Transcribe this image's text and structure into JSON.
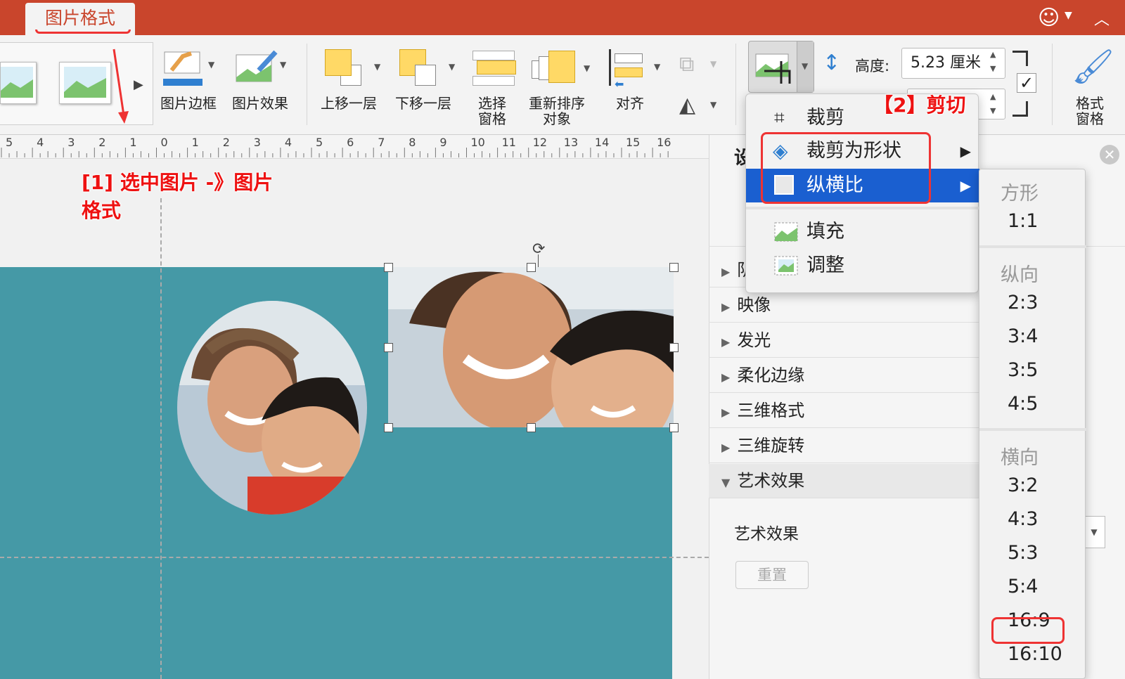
{
  "titlebar": {
    "active_tab": "图片格式",
    "colors": {
      "bar": "#c9452c",
      "accent_red": "#e33333"
    },
    "icons": [
      "smiley-icon",
      "collapse-ribbon-icon"
    ]
  },
  "ribbon": {
    "picture_border": "图片边框",
    "picture_effects": "图片效果",
    "bring_forward": "上移一层",
    "send_backward": "下移一层",
    "selection_pane_1": "选择",
    "selection_pane_2": "窗格",
    "reorder_1": "重新排序",
    "reorder_2": "对象",
    "align": "对齐",
    "height_label": "高度:",
    "height_value": "5.23 厘米",
    "format_pane_1": "格式",
    "format_pane_2": "窗格"
  },
  "ruler": {
    "labels": [
      "5",
      "4",
      "3",
      "2",
      "1",
      "0",
      "1",
      "2",
      "3",
      "4",
      "5",
      "6",
      "7",
      "8",
      "9",
      "10",
      "11",
      "12",
      "13",
      "14",
      "15",
      "16"
    ]
  },
  "annotations": {
    "step1_line1": "[1] 选中图片 -》图片",
    "step1_line2": "格式",
    "step2": "【2】剪切"
  },
  "crop_menu": {
    "crop": "裁剪",
    "crop_to_shape": "裁剪为形状",
    "aspect_ratio": "纵横比",
    "fill": "填充",
    "fit": "调整"
  },
  "aspect_submenu": {
    "square_header": "方形",
    "square": [
      "1:1"
    ],
    "portrait_header": "纵向",
    "portrait": [
      "2:3",
      "3:4",
      "3:5",
      "4:5"
    ],
    "landscape_header": "横向",
    "landscape": [
      "3:2",
      "4:3",
      "5:3",
      "5:4",
      "16:9",
      "16:10"
    ],
    "highlighted": "16:9"
  },
  "format_pane": {
    "heading_fragment": "设",
    "rows": [
      {
        "label": "阴"
      },
      {
        "label": "映像"
      },
      {
        "label": "发光"
      },
      {
        "label": "柔化边缘"
      },
      {
        "label": "三维格式"
      },
      {
        "label": "三维旋转"
      },
      {
        "label": "艺术效果",
        "expanded": true
      }
    ],
    "artistic_effects_label": "艺术效果",
    "reset_button": "重置"
  }
}
